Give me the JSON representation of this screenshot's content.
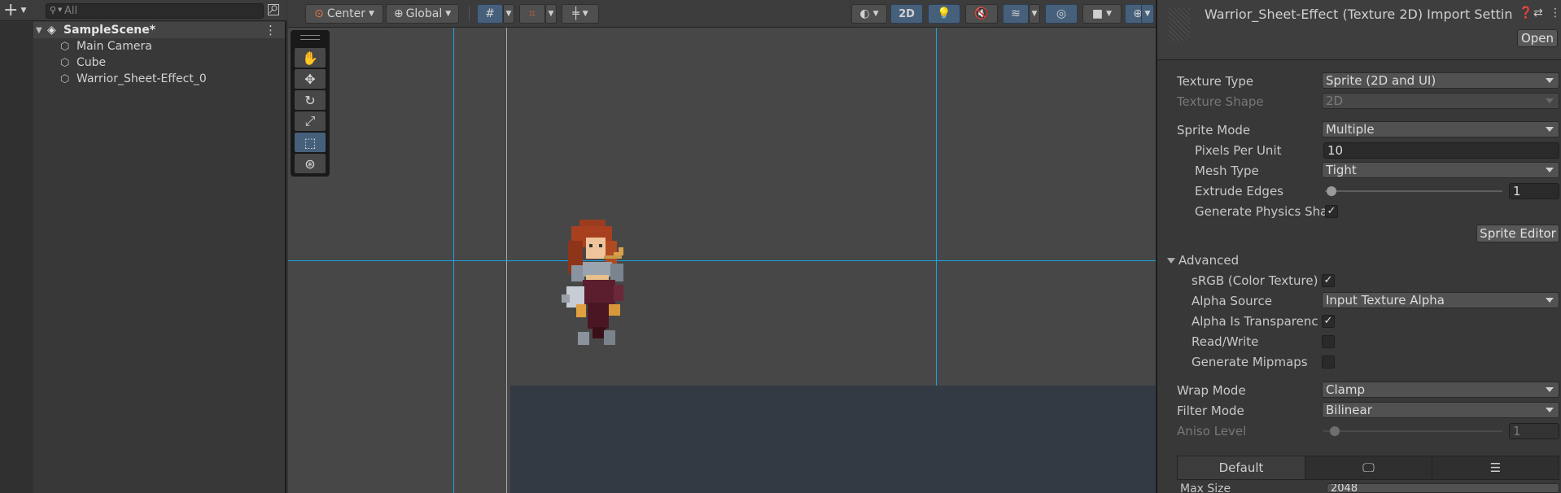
{
  "hierarchy": {
    "add_label": "+",
    "search_placeholder": "All",
    "scene_name": "SampleScene*",
    "items": [
      "Main Camera",
      "Cube",
      "Warrior_Sheet-Effect_0"
    ]
  },
  "scene_toolbar": {
    "pivot_label": "Center",
    "space_label": "Global",
    "mode_2d_label": "2D"
  },
  "inspector": {
    "title": "Warrior_Sheet-Effect (Texture 2D) Import Settin",
    "open_label": "Open",
    "properties": {
      "texture_type_label": "Texture Type",
      "texture_type_value": "Sprite (2D and UI)",
      "texture_shape_label": "Texture Shape",
      "texture_shape_value": "2D",
      "sprite_mode_label": "Sprite Mode",
      "sprite_mode_value": "Multiple",
      "ppu_label": "Pixels Per Unit",
      "ppu_value": "10",
      "mesh_type_label": "Mesh Type",
      "mesh_type_value": "Tight",
      "extrude_label": "Extrude Edges",
      "extrude_value": "1",
      "gen_physics_label": "Generate Physics Sha",
      "sprite_editor_label": "Sprite Editor",
      "advanced_label": "Advanced",
      "srgb_label": "sRGB (Color Texture)",
      "alpha_source_label": "Alpha Source",
      "alpha_source_value": "Input Texture Alpha",
      "alpha_transp_label": "Alpha Is Transparenc",
      "read_write_label": "Read/Write",
      "mipmaps_label": "Generate Mipmaps",
      "wrap_mode_label": "Wrap Mode",
      "wrap_mode_value": "Clamp",
      "filter_mode_label": "Filter Mode",
      "filter_mode_value": "Bilinear",
      "aniso_label": "Aniso Level",
      "aniso_value": "1",
      "max_size_label": "Max Size",
      "max_size_value": "2048"
    },
    "platform_tabs": [
      "Default"
    ]
  },
  "colors": {
    "accent": "#46607c",
    "grid_line": "#1aa3e6",
    "panel_bg": "#383838",
    "scene_bg": "#474747"
  }
}
